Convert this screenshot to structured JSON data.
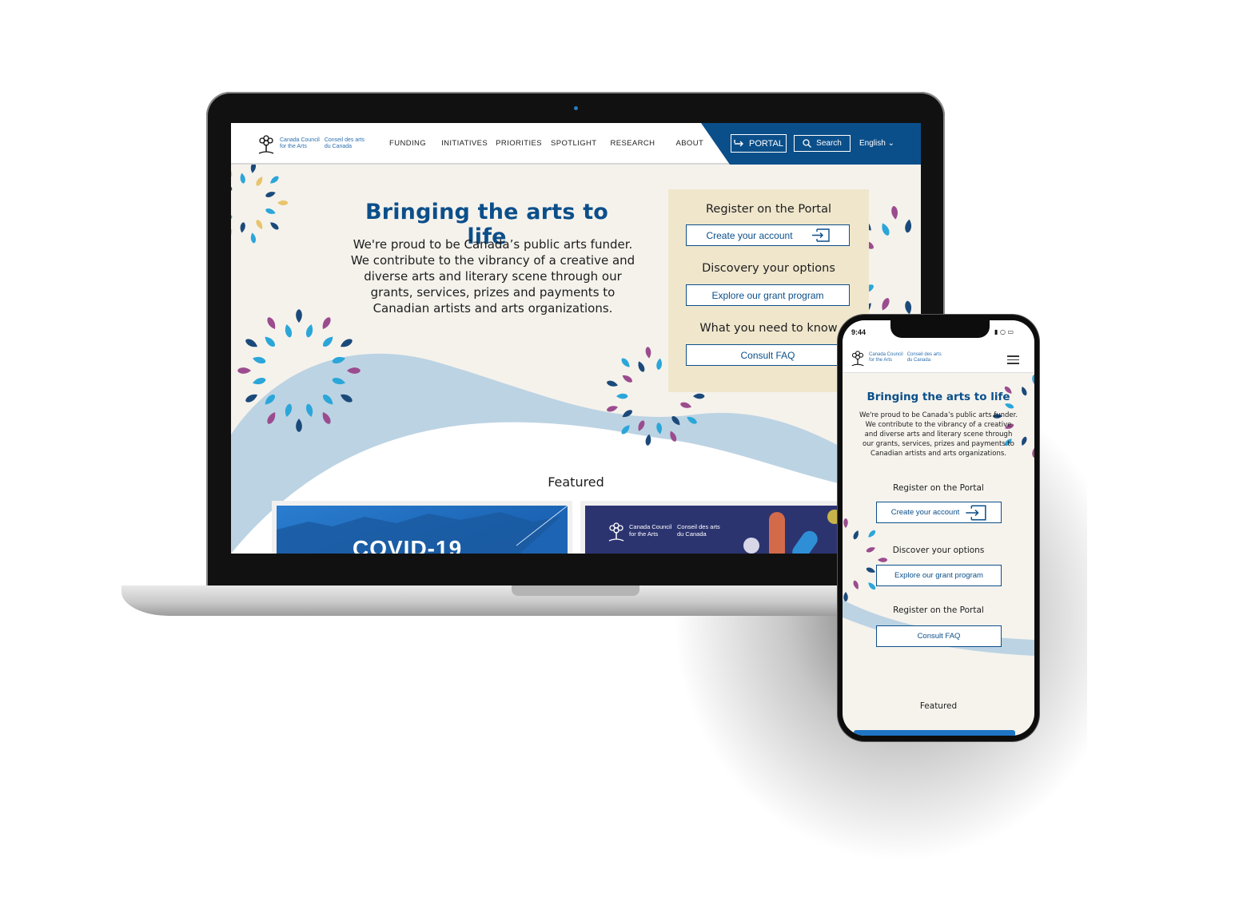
{
  "desktop": {
    "logo": {
      "en_line1": "Canada Council",
      "en_line2": "for the Arts",
      "fr_line1": "Conseil des arts",
      "fr_line2": "du Canada"
    },
    "nav": [
      "FUNDING",
      "INITIATIVES",
      "PRIORITIES",
      "SPOTLIGHT",
      "RESEARCH",
      "ABOUT"
    ],
    "portal_label": "PORTAL",
    "search_label": "Search",
    "language_label": "English",
    "hero": {
      "title": "Bringing the arts to life",
      "body": "We're proud to be Canada’s public arts funder. We contribute to the vibrancy of a creative and diverse arts and literary scene through our grants, services, prizes and payments to Canadian artists and arts organizations."
    },
    "cta": [
      {
        "heading": "Register on the Portal",
        "button": "Create your account"
      },
      {
        "heading": "Discovery your options",
        "button": "Explore our grant program"
      },
      {
        "heading": "What you need to know",
        "button": "Consult FAQ"
      }
    ],
    "featured_label": "Featured",
    "card1_text": "COVID-19",
    "card2_logo": {
      "en_line1": "Canada Council",
      "en_line2": "for the Arts",
      "fr_line1": "Conseil des arts",
      "fr_line2": "du Canada"
    }
  },
  "mobile": {
    "status_time": "9:44",
    "hero": {
      "title": "Bringing the arts to life",
      "body": "We're proud to be Canada’s public arts funder. We contribute to the vibrancy of a creative and diverse arts and literary scene through our grants, services, prizes and payments to Canadian artists and arts organizations."
    },
    "cta": [
      {
        "heading": "Register on the Portal",
        "button": "Create your account"
      },
      {
        "heading": "Discover your options",
        "button": "Explore our grant program"
      },
      {
        "heading": "Register on the Portal",
        "button": "Consult FAQ"
      }
    ],
    "featured_label": "Featured"
  },
  "colors": {
    "brand_blue": "#0b4f8a",
    "cream": "#f5f2ec",
    "cta_panel": "#efe6cc",
    "wave": "#bcd3e3",
    "petal_purple": "#9b4c8e",
    "petal_cyan": "#2ba6d9",
    "petal_navy": "#1b4a7a",
    "petal_gold": "#e8c46a"
  },
  "icons": [
    "tree-logo-icon",
    "portal-arrow-icon",
    "search-icon",
    "chevron-down-icon",
    "hamburger-menu-icon",
    "signal-icon",
    "wifi-icon",
    "battery-icon"
  ]
}
